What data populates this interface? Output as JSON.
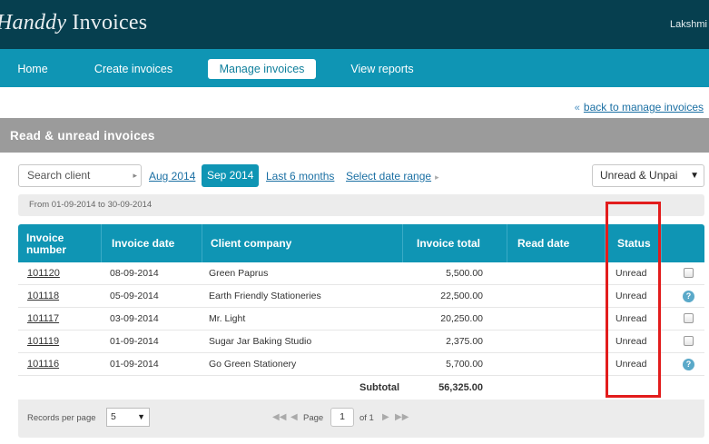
{
  "header": {
    "logo_script": "Handdy",
    "logo_text": " Invoices",
    "user_name": "Lakshmi"
  },
  "nav": {
    "items": [
      {
        "label": "Home"
      },
      {
        "label": "Create invoices"
      },
      {
        "label": "Manage invoices"
      },
      {
        "label": "View reports"
      }
    ]
  },
  "back_link": "back to manage invoices",
  "section_title": "Read & unread invoices",
  "filters": {
    "search_placeholder": "Search client",
    "prev_month": "Aug 2014",
    "current_month": "Sep 2014",
    "last_6_months": "Last 6 months",
    "date_range": "Select date range",
    "status_filter": "Unread & Unpai"
  },
  "date_range_text": "From 01-09-2014 to 30-09-2014",
  "table": {
    "headers": {
      "invoice_number": "Invoice number",
      "invoice_date": "Invoice date",
      "client_company": "Client company",
      "invoice_total": "Invoice total",
      "read_date": "Read date",
      "status": "Status"
    },
    "rows": [
      {
        "number": "101120",
        "date": "08-09-2014",
        "client": "Green Paprus",
        "total": "5,500.00",
        "read_date": "",
        "status": "Unread",
        "action_icon": "checkbox-icon"
      },
      {
        "number": "101118",
        "date": "05-09-2014",
        "client": "Earth Friendly Stationeries",
        "total": "22,500.00",
        "read_date": "",
        "status": "Unread",
        "action_icon": "help-icon"
      },
      {
        "number": "101117",
        "date": "03-09-2014",
        "client": "Mr. Light",
        "total": "20,250.00",
        "read_date": "",
        "status": "Unread",
        "action_icon": "checkbox-icon"
      },
      {
        "number": "101119",
        "date": "01-09-2014",
        "client": "Sugar Jar Baking Studio",
        "total": "2,375.00",
        "read_date": "",
        "status": "Unread",
        "action_icon": "checkbox-icon"
      },
      {
        "number": "101116",
        "date": "01-09-2014",
        "client": "Go Green Stationery",
        "total": "5,700.00",
        "read_date": "",
        "status": "Unread",
        "action_icon": "help-icon"
      }
    ],
    "subtotal_label": "Subtotal",
    "subtotal_value": "56,325.00"
  },
  "pager": {
    "records_label": "Records per page",
    "records_value": "5",
    "page_label": "Page",
    "page_value": "1",
    "of_label": "of 1"
  },
  "colors": {
    "header_bg": "#063f4f",
    "nav_bg": "#0f95b4",
    "section_bg": "#9b9b9b",
    "highlight": "#e21c1c"
  }
}
